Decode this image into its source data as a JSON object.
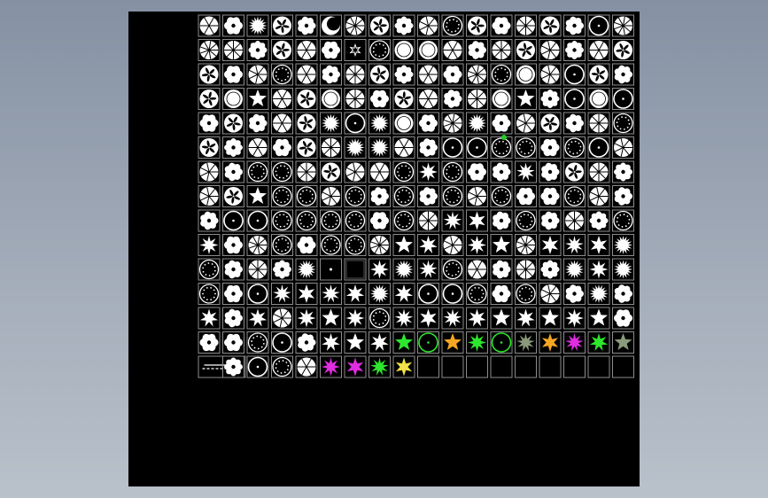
{
  "viewport": {
    "background_colors": [
      "#8591a3",
      "#b9c1cb"
    ],
    "canvas_color": "#000000"
  },
  "symbol_library": {
    "rows": 15,
    "columns": 18,
    "frame_color": "#8c8c8c",
    "default_symbol_color": "#ffffff",
    "row_symbols": [
      [
        "circle-spokes",
        "circle-lobed",
        "starburst",
        "circle-leaves",
        "circle-lobed",
        "circle-crescent",
        "circle-spokes",
        "circle-leaves",
        "circle-lobed",
        "circle-spokes",
        "dots-ring",
        "circle-leaves",
        "circle-lobed",
        "circle-spokes",
        "circle-leaves",
        "circle-lobed",
        "ring",
        "circle-spokes"
      ],
      [
        "circle-spokes",
        "circle-spokes",
        "circle-lobed",
        "circle-leaves",
        "circle-spokes",
        "circle-lobed",
        "star-small",
        "dots-ring",
        "filled-circle",
        "filled-circle",
        "circle-spokes",
        "circle-lobed",
        "circle-spokes",
        "circle-leaves",
        "circle-spokes",
        "circle-lobed",
        "circle-spokes",
        "circle-leaves"
      ],
      [
        "circle-leaves",
        "circle-lobed",
        "circle-spokes",
        "dots-ring",
        "circle-spokes",
        "circle-lobed",
        "circle-spokes",
        "circle-leaves",
        "circle-lobed",
        "circle-spokes",
        "circle-lobed",
        "circle-spokes",
        "dots-ring",
        "filled-circle",
        "circle-spokes",
        "ring",
        "circle-leaves",
        "circle-lobed"
      ],
      [
        "circle-leaves",
        "filled-circle",
        "star",
        "circle-spokes",
        "circle-leaves",
        "filled-circle",
        "circle-spokes",
        "circle-lobed",
        "circle-leaves",
        "circle-spokes",
        "circle-lobed",
        "circle-spokes",
        "filled-circle",
        "star",
        "circle-lobed",
        "ring",
        "filled-circle",
        "ring"
      ],
      [
        "circle-lobed",
        "circle-leaves",
        "circle-lobed",
        "circle-spokes",
        "circle-leaves",
        "starburst",
        "ring",
        "starburst",
        "filled-circle",
        "circle-lobed",
        "circle-spokes",
        "starburst",
        "circle-lobed",
        "circle-spokes",
        "circle-leaves",
        "circle-lobed",
        "circle-spokes",
        "dots-ring"
      ],
      [
        "circle-leaves",
        "circle-lobed",
        "circle-spokes",
        "circle-lobed",
        "circle-leaves",
        "circle-spokes",
        "starburst",
        "starburst",
        "circle-spokes",
        "circle-lobed",
        "ring",
        "ring",
        "dots-ring",
        "dots-ring",
        "circle-lobed",
        "dots-ring",
        "ring",
        "circle-spokes"
      ],
      [
        "circle-spokes",
        "circle-lobed",
        "dots-ring",
        "dots-ring",
        "circle-spokes",
        "circle-leaves",
        "circle-spokes",
        "circle-spokes",
        "dots-ring",
        "star",
        "dots-ring",
        "circle-lobed",
        "circle-lobed",
        "star",
        "circle-lobed",
        "circle-leaves",
        "circle-spokes",
        "circle-lobed"
      ],
      [
        "circle-spokes",
        "circle-leaves",
        "star",
        "dots-ring",
        "dots-ring",
        "circle-spokes",
        "dots-ring",
        "circle-lobed",
        "dots-ring",
        "circle-lobed",
        "dots-ring",
        "circle-spokes",
        "dots-ring",
        "circle-lobed",
        "circle-lobed",
        "dots-ring",
        "circle-spokes",
        "circle-lobed"
      ],
      [
        "circle-lobed",
        "ring",
        "ring",
        "dots-ring",
        "dots-ring",
        "dots-ring",
        "dots-ring",
        "circle-lobed",
        "dots-ring",
        "circle-spokes",
        "star",
        "star",
        "circle-lobed",
        "dots-ring",
        "circle-lobed",
        "circle-spokes",
        "circle-lobed",
        "dots-ring"
      ],
      [
        "star",
        "circle-lobed",
        "circle-spokes",
        "dots-ring",
        "circle-lobed",
        "dots-ring",
        "dots-ring",
        "circle-spokes",
        "star",
        "star",
        "circle-spokes",
        "star",
        "star",
        "circle-spokes",
        "star",
        "star",
        "star",
        "starburst"
      ],
      [
        "dots-ring",
        "circle-lobed",
        "circle-spokes",
        "circle-lobed",
        "starburst",
        "dot",
        "box",
        "star",
        "starburst",
        "star",
        "dots-ring",
        "circle-spokes",
        "circle-lobed",
        "circle-spokes",
        "circle-lobed",
        "starburst",
        "star",
        "starburst"
      ],
      [
        "dots-ring",
        "circle-lobed",
        "ring",
        "star",
        "star",
        "star",
        "star",
        "starburst",
        "star",
        "ring",
        "ring",
        "dots-ring",
        "circle-lobed",
        "dots-ring",
        "circle-spokes",
        "circle-lobed",
        "starburst",
        "circle-lobed"
      ],
      [
        "star",
        "circle-lobed",
        "star",
        "circle-spokes",
        "star",
        "star",
        "star",
        "dots-ring",
        "star",
        "star",
        "star",
        "star",
        "star",
        "star",
        "star",
        "star",
        "star",
        "circle-lobed"
      ],
      [
        "circle-lobed",
        "circle-lobed",
        "dots-ring",
        "ring",
        "circle-lobed",
        "star",
        "star",
        "star",
        "star-green",
        "ring-green",
        "star-orange",
        "star-green",
        "ring-green",
        "star-gray",
        "star-orange",
        "star-magenta",
        "star-green",
        "star-gray"
      ],
      [
        "divider",
        "circle-lobed",
        "ring",
        "dots-ring",
        "circle-spokes",
        "star-magenta",
        "star-magenta",
        "star-green",
        "star-yellow",
        "empty",
        "empty",
        "empty",
        "empty",
        "empty",
        "empty",
        "empty",
        "empty",
        "empty"
      ]
    ],
    "symbol_colors": {
      "star-green": "#2ee62e",
      "ring-green": "#2ee62e",
      "star-orange": "#f5a623",
      "star-gray": "#8a9a7a",
      "star-magenta": "#e02de0",
      "star-yellow": "#f3e04a"
    },
    "selection_marker_color": "#1ecf1e"
  }
}
